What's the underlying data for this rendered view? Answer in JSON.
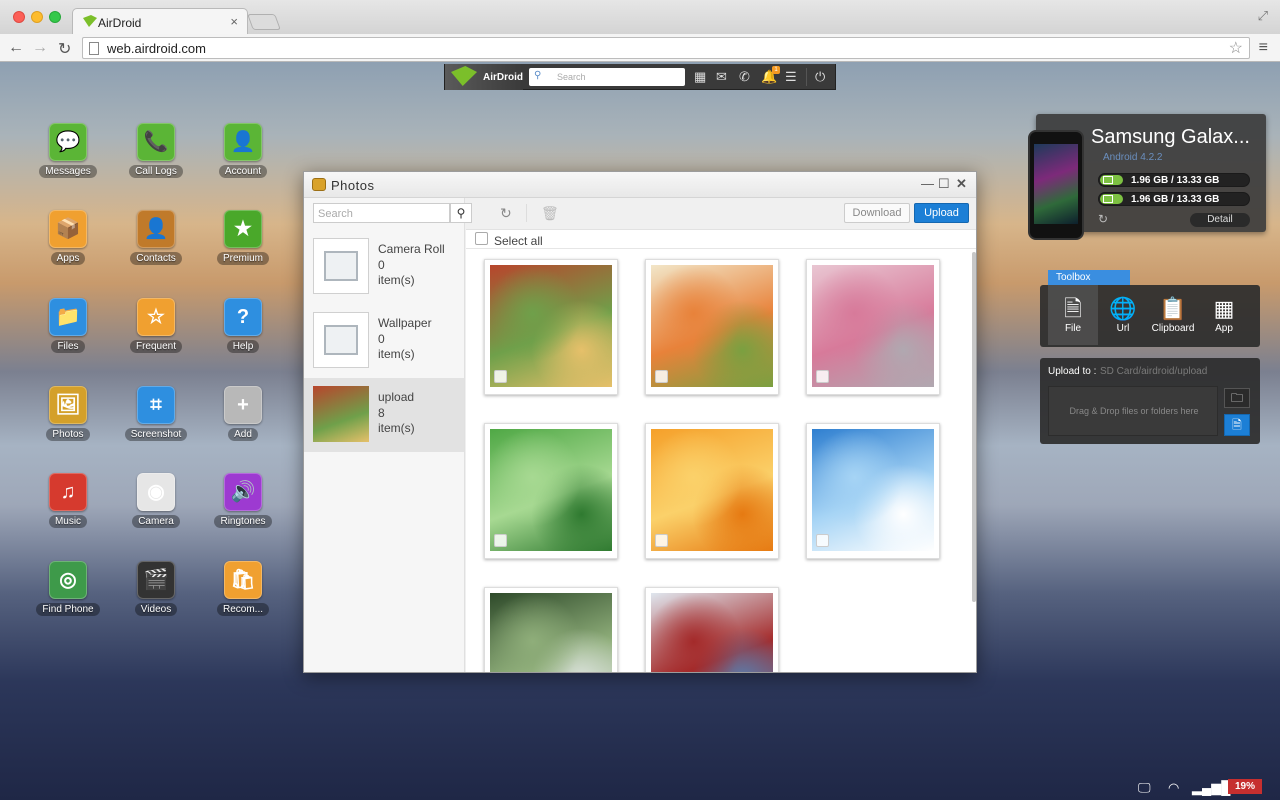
{
  "browser": {
    "tab_title": "AirDroid",
    "tab_close": "×",
    "url": "web.airdroid.com",
    "star": "☆",
    "menu": "≡",
    "back": "←",
    "forward": "→",
    "reload": "↻",
    "fullscreen": "⤢"
  },
  "airdroid_bar": {
    "logo_text": "AirDroid",
    "search_placeholder": "Search",
    "notification_count": "1",
    "icons": [
      "apps-icon",
      "mail-icon",
      "phone-icon",
      "bell-icon",
      "list-icon",
      "power-icon"
    ]
  },
  "desktop_apps": [
    {
      "label": "Messages",
      "color": "#5bb536",
      "glyph": "💬"
    },
    {
      "label": "Call Logs",
      "color": "#5bb536",
      "glyph": "📞"
    },
    {
      "label": "Account",
      "color": "#5bb536",
      "glyph": "👤"
    },
    {
      "label": "Apps",
      "color": "#f0a030",
      "glyph": "📦"
    },
    {
      "label": "Contacts",
      "color": "#c07a2a",
      "glyph": "👤"
    },
    {
      "label": "Premium",
      "color": "#4aa82a",
      "glyph": "★"
    },
    {
      "label": "Files",
      "color": "#2e8fe0",
      "glyph": "📁"
    },
    {
      "label": "Frequent",
      "color": "#f0a030",
      "glyph": "☆"
    },
    {
      "label": "Help",
      "color": "#2e8fe0",
      "glyph": "?"
    },
    {
      "label": "Photos",
      "color": "#d4a02a",
      "glyph": "🖼"
    },
    {
      "label": "Screenshot",
      "color": "#2e8fe0",
      "glyph": "⌗"
    },
    {
      "label": "Add",
      "color": "#b8b8b8",
      "glyph": "+"
    },
    {
      "label": "Music",
      "color": "#d63a2e",
      "glyph": "♫"
    },
    {
      "label": "Camera",
      "color": "#e6e6e6",
      "glyph": "◉"
    },
    {
      "label": "Ringtones",
      "color": "#9d3ad1",
      "glyph": "🔊"
    },
    {
      "label": "Find Phone",
      "color": "#3e9a4a",
      "glyph": "◎"
    },
    {
      "label": "Videos",
      "color": "#333333",
      "glyph": "🎬"
    },
    {
      "label": "Recom...",
      "color": "#f0a030",
      "glyph": "🛍"
    }
  ],
  "photos_window": {
    "title": "Photos",
    "search_placeholder": "Search",
    "download_label": "Download",
    "upload_label": "Upload",
    "select_all_label": "Select all",
    "albums": [
      {
        "name": "Camera Roll",
        "count": "0",
        "unit": "item(s)"
      },
      {
        "name": "Wallpaper",
        "count": "0",
        "unit": "item(s)"
      },
      {
        "name": "upload",
        "count": "8",
        "unit": "item(s)"
      }
    ],
    "photos": [
      {
        "subject": "cafe-facade",
        "colors": [
          "#b8452c",
          "#6fa04a",
          "#e6c06a"
        ]
      },
      {
        "subject": "shrimp-pasta",
        "colors": [
          "#f2e6c8",
          "#e8823a",
          "#7aa040"
        ]
      },
      {
        "subject": "cherry-blossoms",
        "colors": [
          "#e9c6d2",
          "#d77a9a",
          "#b0a8b0"
        ]
      },
      {
        "subject": "green-grass-bokeh",
        "colors": [
          "#4fa845",
          "#a7d992",
          "#2f7a30"
        ]
      },
      {
        "subject": "orange-slices",
        "colors": [
          "#f5a02a",
          "#fbd16a",
          "#e67a12"
        ]
      },
      {
        "subject": "blue-sky-flowers",
        "colors": [
          "#2f7fd0",
          "#a6d4f5",
          "#ffffff"
        ]
      },
      {
        "subject": "forest-stream",
        "colors": [
          "#2e4a2a",
          "#8fae7a",
          "#d8e0d8"
        ]
      },
      {
        "subject": "winter-barn",
        "colors": [
          "#dfe6ee",
          "#a42a2a",
          "#5c7aa8"
        ]
      }
    ]
  },
  "device": {
    "name": "Samsung Galax...",
    "os": "Android 4.2.2",
    "storage": [
      {
        "text": "1.96 GB / 13.33 GB",
        "fraction": 0.15
      },
      {
        "text": "1.96 GB / 13.33 GB",
        "fraction": 0.15
      }
    ],
    "detail_label": "Detail"
  },
  "toolbox": {
    "title": "Toolbox",
    "items": [
      {
        "label": "File",
        "glyph": "🗎"
      },
      {
        "label": "Url",
        "glyph": "🌐"
      },
      {
        "label": "Clipboard",
        "glyph": "📋"
      },
      {
        "label": "App",
        "glyph": "▦"
      }
    ],
    "upload_to_label": "Upload to :",
    "upload_path": "SD Card/airdroid/upload",
    "drop_hint": "Drag & Drop files or folders here"
  },
  "statusbar": {
    "battery": "19%"
  }
}
